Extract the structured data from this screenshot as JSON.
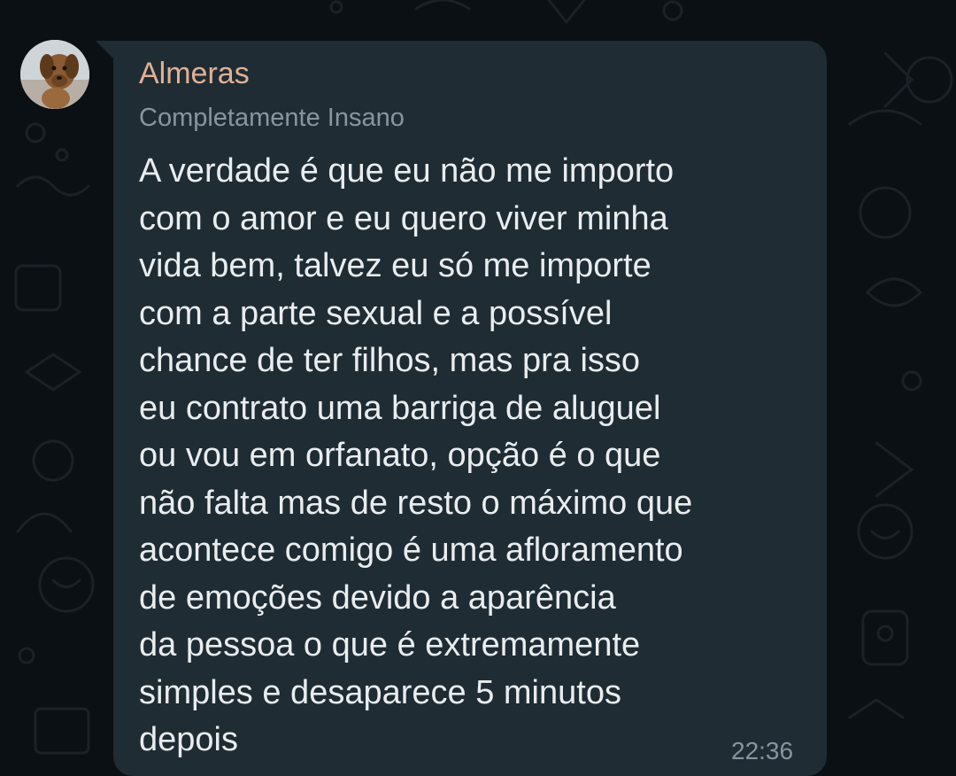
{
  "message": {
    "sender_name": "Almeras",
    "sender_status": "Completamente Insano",
    "lines": [
      "A verdade é que eu não me importo",
      "com o amor e eu quero viver minha",
      "vida bem, talvez eu só me importe",
      "com a parte sexual e a possível",
      "chance de ter filhos, mas pra isso",
      "eu contrato uma barriga de aluguel",
      "ou vou em orfanato, opção é o que",
      "não falta mas de resto o máximo que",
      "acontece comigo é uma afloramento",
      "de emoções devido a aparência",
      "da pessoa o que é extremamente",
      "simples e desaparece 5 minutos",
      "depois"
    ],
    "time": "22:36",
    "avatar_icon": "dog-avatar-icon"
  },
  "colors": {
    "background": "#0b1014",
    "bubble": "#1f2c34",
    "sender_name": "#e1b195",
    "secondary_text": "#8696a0",
    "message_text": "#e9edef"
  }
}
